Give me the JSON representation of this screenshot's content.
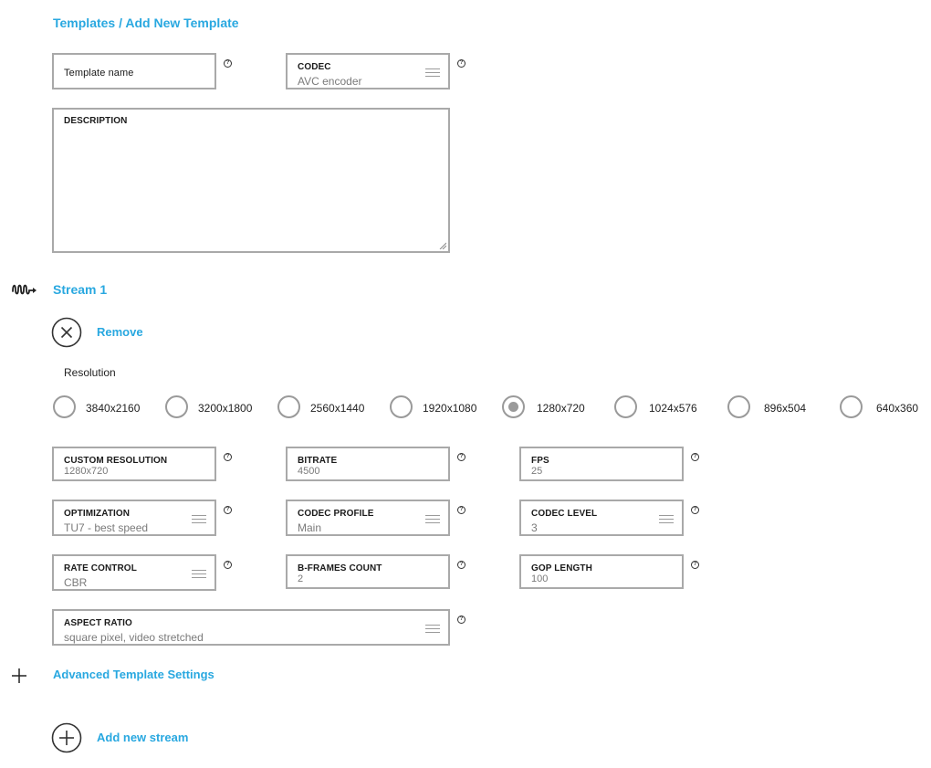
{
  "breadcrumb": "Templates / Add New Template",
  "template_name": {
    "label": "Template name"
  },
  "codec": {
    "label": "CODEC",
    "value": "AVC encoder"
  },
  "description": {
    "label": "DESCRIPTION"
  },
  "stream": {
    "title": "Stream 1",
    "remove_label": "Remove",
    "resolution_label": "Resolution",
    "resolutions": [
      "3840x2160",
      "3200x1800",
      "2560x1440",
      "1920x1080",
      "1280x720",
      "1024x576",
      "896x504",
      "640x360"
    ],
    "selected_resolution": "1280x720",
    "custom_resolution": {
      "label": "CUSTOM RESOLUTION",
      "value": "1280x720"
    },
    "bitrate": {
      "label": "BITRATE",
      "value": "4500"
    },
    "fps": {
      "label": "FPS",
      "value": "25"
    },
    "optimization": {
      "label": "OPTIMIZATION",
      "value": "TU7 - best speed"
    },
    "codec_profile": {
      "label": "CODEC PROFILE",
      "value": "Main"
    },
    "codec_level": {
      "label": "CODEC LEVEL",
      "value": "3"
    },
    "rate_control": {
      "label": "RATE CONTROL",
      "value": "CBR"
    },
    "bframes": {
      "label": "B-FRAMES COUNT",
      "value": "2"
    },
    "gop_length": {
      "label": "GOP LENGTH",
      "value": "100"
    },
    "aspect_ratio": {
      "label": "ASPECT RATIO",
      "value": "square pixel, video stretched"
    }
  },
  "advanced_label": "Advanced Template Settings",
  "add_stream_label": "Add new stream",
  "help_glyph": "?",
  "colors": {
    "accent": "#29a8e0",
    "border": "#a9a9a9",
    "value_text": "#7a7a7a"
  }
}
